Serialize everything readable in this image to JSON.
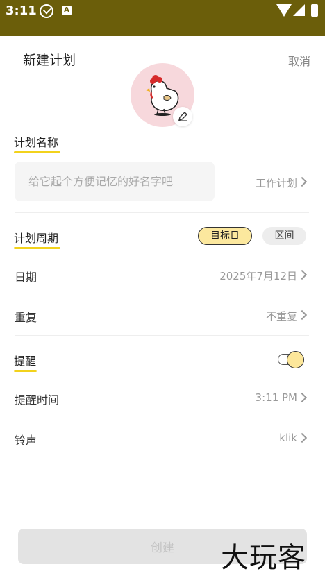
{
  "status_bar": {
    "time": "3:11",
    "icons": [
      "check-circle-icon",
      "a-icon",
      "wifi-icon",
      "signal-icon",
      "battery-icon"
    ]
  },
  "header": {
    "title": "新建计划",
    "cancel_label": "取消"
  },
  "avatar": {
    "icon": "chicken-avatar",
    "edit_icon": "pencil-icon"
  },
  "plan_name": {
    "label": "计划名称",
    "placeholder": "给它起个方便记忆的好名字吧",
    "value": "",
    "category": "工作计划"
  },
  "plan_period": {
    "label": "计划周期",
    "options": [
      "目标日",
      "区间"
    ],
    "selected": "目标日"
  },
  "date_row": {
    "label": "日期",
    "value": "2025年7月12日"
  },
  "repeat_row": {
    "label": "重复",
    "value": "不重复"
  },
  "reminder": {
    "label": "提醒",
    "enabled": true
  },
  "reminder_time_row": {
    "label": "提醒时间",
    "value": "3:11 PM"
  },
  "ringtone_row": {
    "label": "铃声",
    "value": "klik"
  },
  "create_button": {
    "label": "创建"
  },
  "watermark": "大玩客",
  "colors": {
    "status_bar": "#6b5e0a",
    "accent_yellow": "#f2d21c",
    "pill_active": "#fce89e"
  }
}
